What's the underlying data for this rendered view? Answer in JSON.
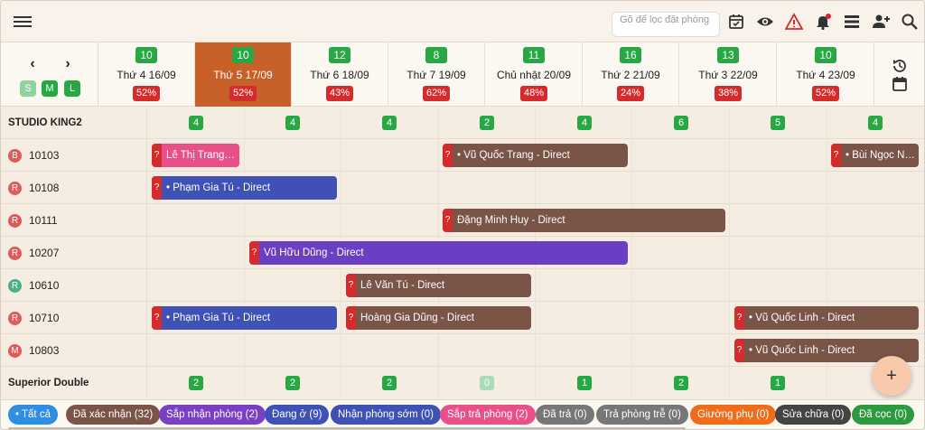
{
  "toolbar": {
    "search_placeholder": "Gõ để lọc đặt phòng"
  },
  "nav": {
    "prev": "‹",
    "next": "›",
    "sizes": [
      "S",
      "M",
      "L"
    ]
  },
  "days": [
    {
      "count": "10",
      "label": "Thứ 4 16/09",
      "pct": "52%"
    },
    {
      "count": "10",
      "label": "Thứ 5 17/09",
      "pct": "52%",
      "active": true
    },
    {
      "count": "12",
      "label": "Thứ 6 18/09",
      "pct": "43%"
    },
    {
      "count": "8",
      "label": "Thứ 7 19/09",
      "pct": "62%"
    },
    {
      "count": "11",
      "label": "Chủ nhật 20/09",
      "pct": "48%"
    },
    {
      "count": "16",
      "label": "Thứ 2 21/09",
      "pct": "24%"
    },
    {
      "count": "13",
      "label": "Thứ 3 22/09",
      "pct": "38%"
    },
    {
      "count": "10",
      "label": "Thứ 4 23/09",
      "pct": "52%"
    }
  ],
  "groups": {
    "g1": {
      "name": "STUDIO KING2",
      "counts": [
        "4",
        "4",
        "4",
        "2",
        "4",
        "6",
        "5",
        "4"
      ]
    },
    "g2": {
      "name": "Superior Double",
      "counts": [
        "2",
        "2",
        "2",
        "0",
        "1",
        "2",
        "1",
        ""
      ]
    }
  },
  "rooms": [
    {
      "badge": "B",
      "color": "#e05a5a",
      "number": "10103"
    },
    {
      "badge": "R",
      "color": "#e05a5a",
      "number": "10108"
    },
    {
      "badge": "R",
      "color": "#e05a5a",
      "number": "10111"
    },
    {
      "badge": "R",
      "color": "#e05a5a",
      "number": "10207"
    },
    {
      "badge": "R",
      "color": "#4caf8a",
      "number": "10610"
    },
    {
      "badge": "R",
      "color": "#e05a5a",
      "number": "10710"
    },
    {
      "badge": "M",
      "color": "#e05a5a",
      "number": "10803"
    }
  ],
  "bookings": [
    {
      "q": "?",
      "text": "Lê Thị Trang - ..."
    },
    {
      "q": "?",
      "text": "• Vũ Quốc Trang - Direct"
    },
    {
      "q": "?",
      "text": "• Bùi Ngọc Na..."
    },
    {
      "q": "?",
      "text": "• Phạm Gia Tú - Direct"
    },
    {
      "q": "?",
      "text": "Đặng Minh Huy - Direct"
    },
    {
      "q": "?",
      "text": "Vũ Hữu Dũng - Direct"
    },
    {
      "q": "?",
      "text": "Lê Văn Tú - Direct"
    },
    {
      "q": "?",
      "text": "• Phạm Gia Tú - Direct"
    },
    {
      "q": "?",
      "text": "Hoàng Gia Dũng - Direct"
    },
    {
      "q": "?",
      "text": "• Vũ Quốc Linh - Direct"
    },
    {
      "q": "?",
      "text": "• Vũ Quốc Linh - Direct"
    }
  ],
  "fab": "+",
  "filters": [
    {
      "label": "• Tất cả",
      "color": "#2f8de4"
    },
    {
      "label": "Đã xác nhận (32)",
      "color": "#7a5446"
    },
    {
      "label": "Sắp nhận phòng (2)",
      "color": "#7b3fc4"
    },
    {
      "label": "Đang ở (9)",
      "color": "#3f51b5"
    },
    {
      "label": "Nhận phòng sớm (0)",
      "color": "#3f51b5"
    },
    {
      "label": "Sắp trả phòng (2)",
      "color": "#e9508a"
    },
    {
      "label": "Đã trả (0)",
      "color": "#777777"
    },
    {
      "label": "Trả phòng trễ (0)",
      "color": "#777777"
    },
    {
      "label": "Giường phụ (0)",
      "color": "#ef6c1a"
    },
    {
      "label": "Sửa chữa (0)",
      "color": "#444444"
    },
    {
      "label": "Đã cọc (0)",
      "color": "#2e9a3e"
    }
  ],
  "colors": {
    "active_day": "#c8602a",
    "count_green": "#27a844",
    "pct_red": "#d42c2c",
    "booking_brown": "#7a5446",
    "booking_blue": "#3f51b5",
    "booking_pink": "#e9508a",
    "booking_purple": "#6a3fc4"
  }
}
